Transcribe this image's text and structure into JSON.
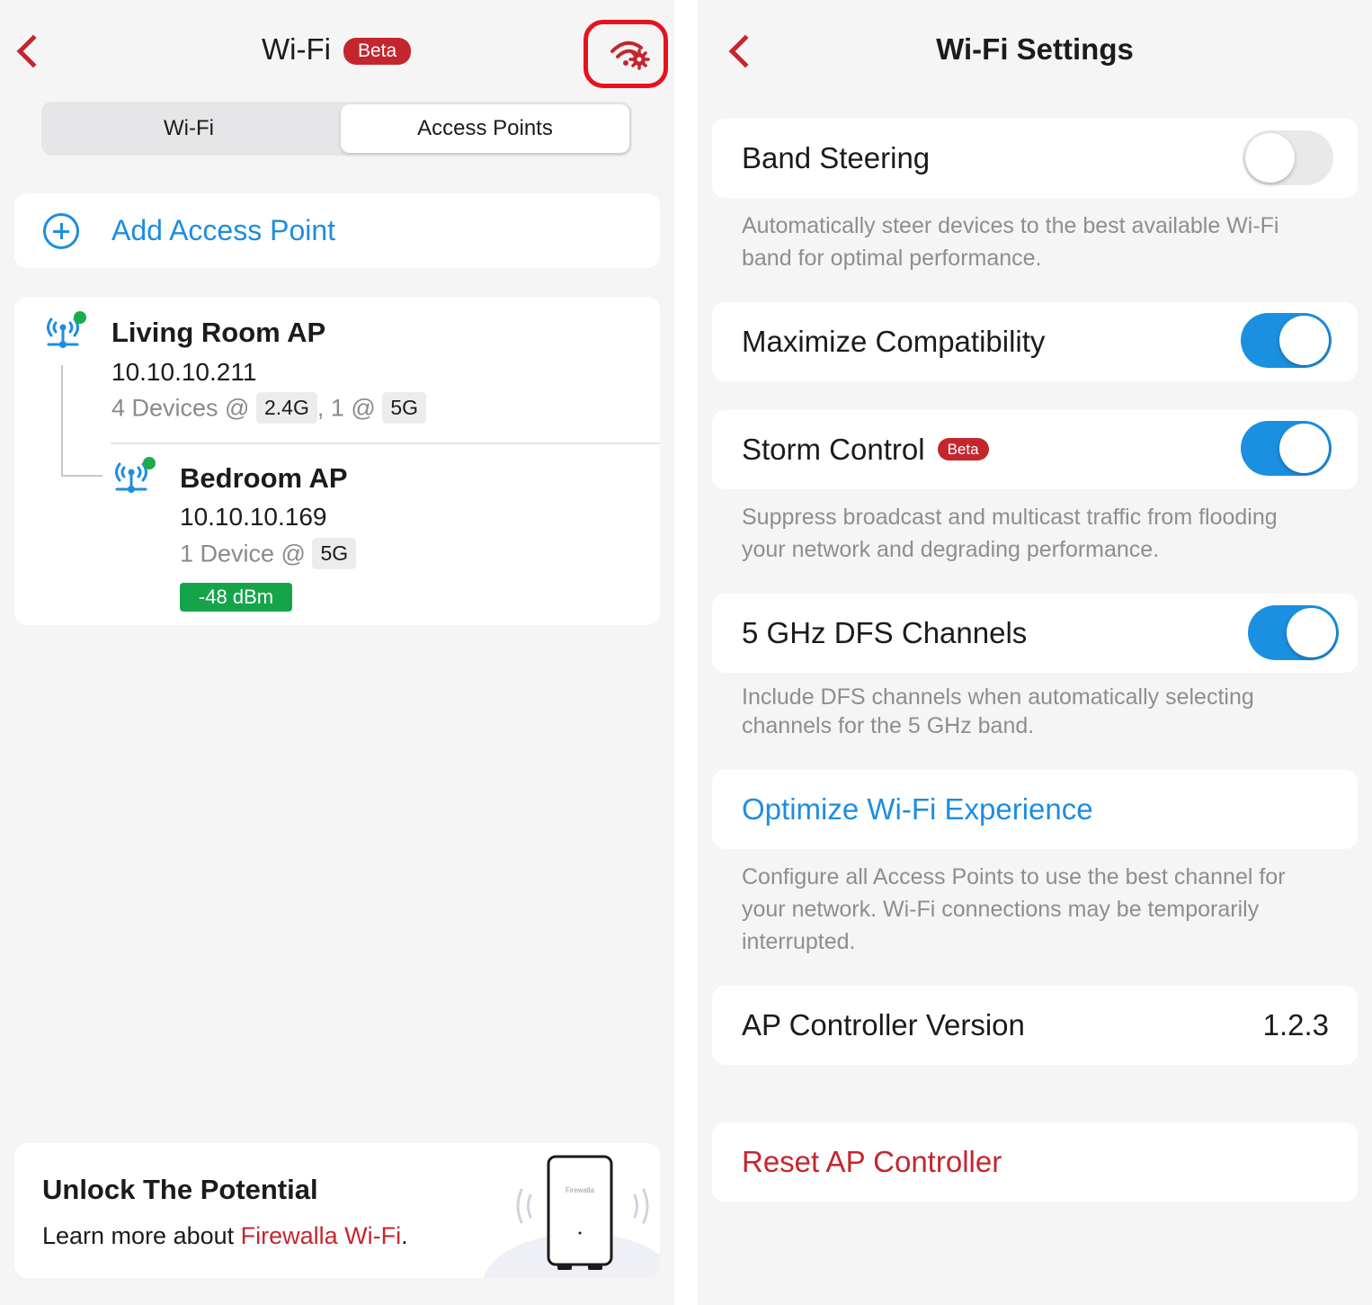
{
  "left": {
    "header": {
      "title": "Wi-Fi",
      "badge": "Beta"
    },
    "tabs": [
      {
        "label": "Wi-Fi",
        "selected": false
      },
      {
        "label": "Access Points",
        "selected": true
      }
    ],
    "add_button": {
      "label": "Add Access Point"
    },
    "access_points": [
      {
        "name": "Living Room AP",
        "ip": "10.10.10.211",
        "devices_prefix": "4 Devices @",
        "band1": "2.4G",
        "separator": ", 1 @",
        "band2": "5G",
        "online": true
      },
      {
        "name": "Bedroom AP",
        "ip": "10.10.10.169",
        "devices_prefix": "1 Device @",
        "band1": "5G",
        "signal": "-48 dBm",
        "online": true
      }
    ],
    "promo": {
      "title": "Unlock The Potential",
      "text_prefix": "Learn more about ",
      "link": "Firewalla Wi-Fi",
      "text_suffix": ".",
      "device_label": "Firewalla"
    }
  },
  "right": {
    "header": {
      "title": "Wi-Fi Settings"
    },
    "settings": [
      {
        "label": "Band Steering",
        "enabled": false,
        "note": "Automatically steer devices to the best available Wi-Fi band for optimal performance."
      },
      {
        "label": "Maximize Compatibility",
        "enabled": true
      },
      {
        "label": "Storm Control",
        "badge": "Beta",
        "enabled": true,
        "note": "Suppress broadcast and multicast traffic from flooding your network and degrading performance."
      },
      {
        "label": "5 GHz DFS Channels",
        "enabled": true,
        "note": "Include DFS channels when automatically selecting channels for the 5 GHz band."
      }
    ],
    "optimize": {
      "label": "Optimize Wi-Fi Experience",
      "note": "Configure all Access Points to use the best channel for your network. Wi-Fi connections may be temporarily interrupted."
    },
    "version": {
      "label": "AP Controller Version",
      "value": "1.2.3"
    },
    "reset": {
      "label": "Reset AP Controller"
    }
  },
  "colors": {
    "accent_red": "#c4262e",
    "link_blue": "#1e8de0",
    "toggle_on": "#1b8fe0",
    "signal_green": "#16a44a",
    "status_online": "#1aac4c"
  },
  "icons": [
    "back-chevron-icon",
    "wifi-settings-icon",
    "add-circle-icon",
    "access-point-icon"
  ]
}
